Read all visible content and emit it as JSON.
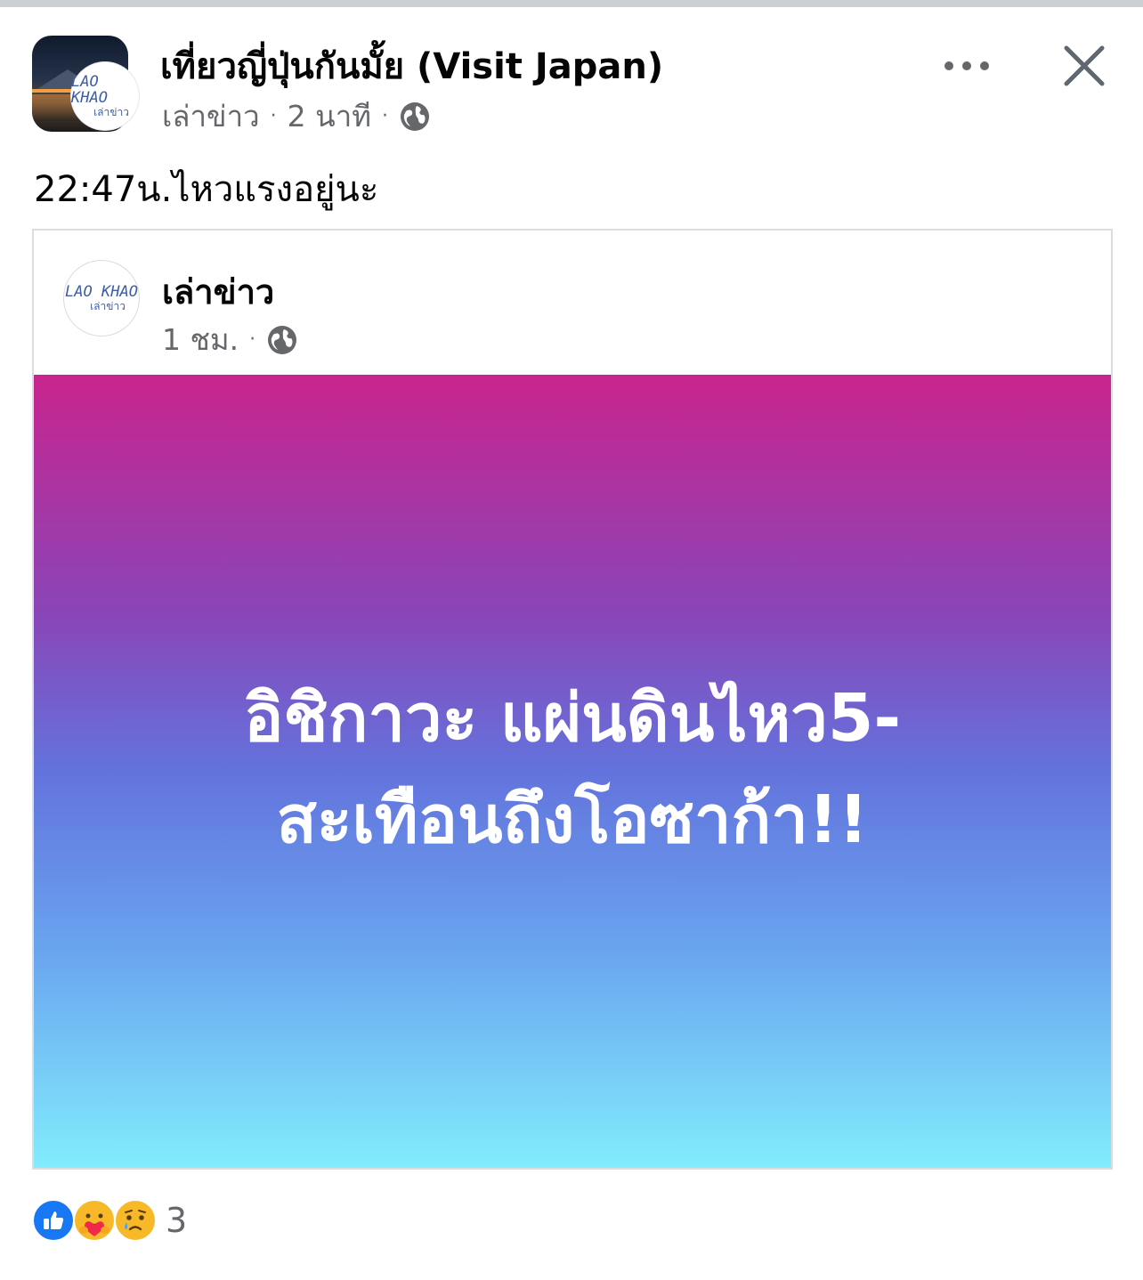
{
  "post": {
    "group_name": "เที่ยวญี่ปุ่นกันมั้ย (Visit Japan)",
    "author": "เล่าข่าว",
    "time": "2 นาที",
    "separator": "·",
    "caption": "22:47น.ไหวแรงอยู่นะ",
    "avatar_logo_text": "LAO KHAO",
    "avatar_logo_sub": "เล่าข่าว",
    "icons": {
      "more": "more-horizontal-icon",
      "close": "close-icon",
      "privacy": "globe-icon"
    }
  },
  "shared": {
    "page_name": "เล่าข่าว",
    "time": "1 ชม.",
    "separator": "·",
    "logo_text": "LAO KHAO",
    "logo_sub": "เล่าข่าว",
    "background_text_line1": "อิชิกาวะ แผ่นดินไหว5-",
    "background_text_line2": "สะเทือนถึงโอซาก้า!!",
    "gradient_colors": [
      "#c9248d",
      "#6373dd",
      "#82ecfd"
    ]
  },
  "reactions": {
    "types": [
      "like",
      "care",
      "sad"
    ],
    "count": "3"
  },
  "colors": {
    "text_primary": "#050505",
    "text_secondary": "#65676b",
    "like_blue": "#1877f2"
  }
}
